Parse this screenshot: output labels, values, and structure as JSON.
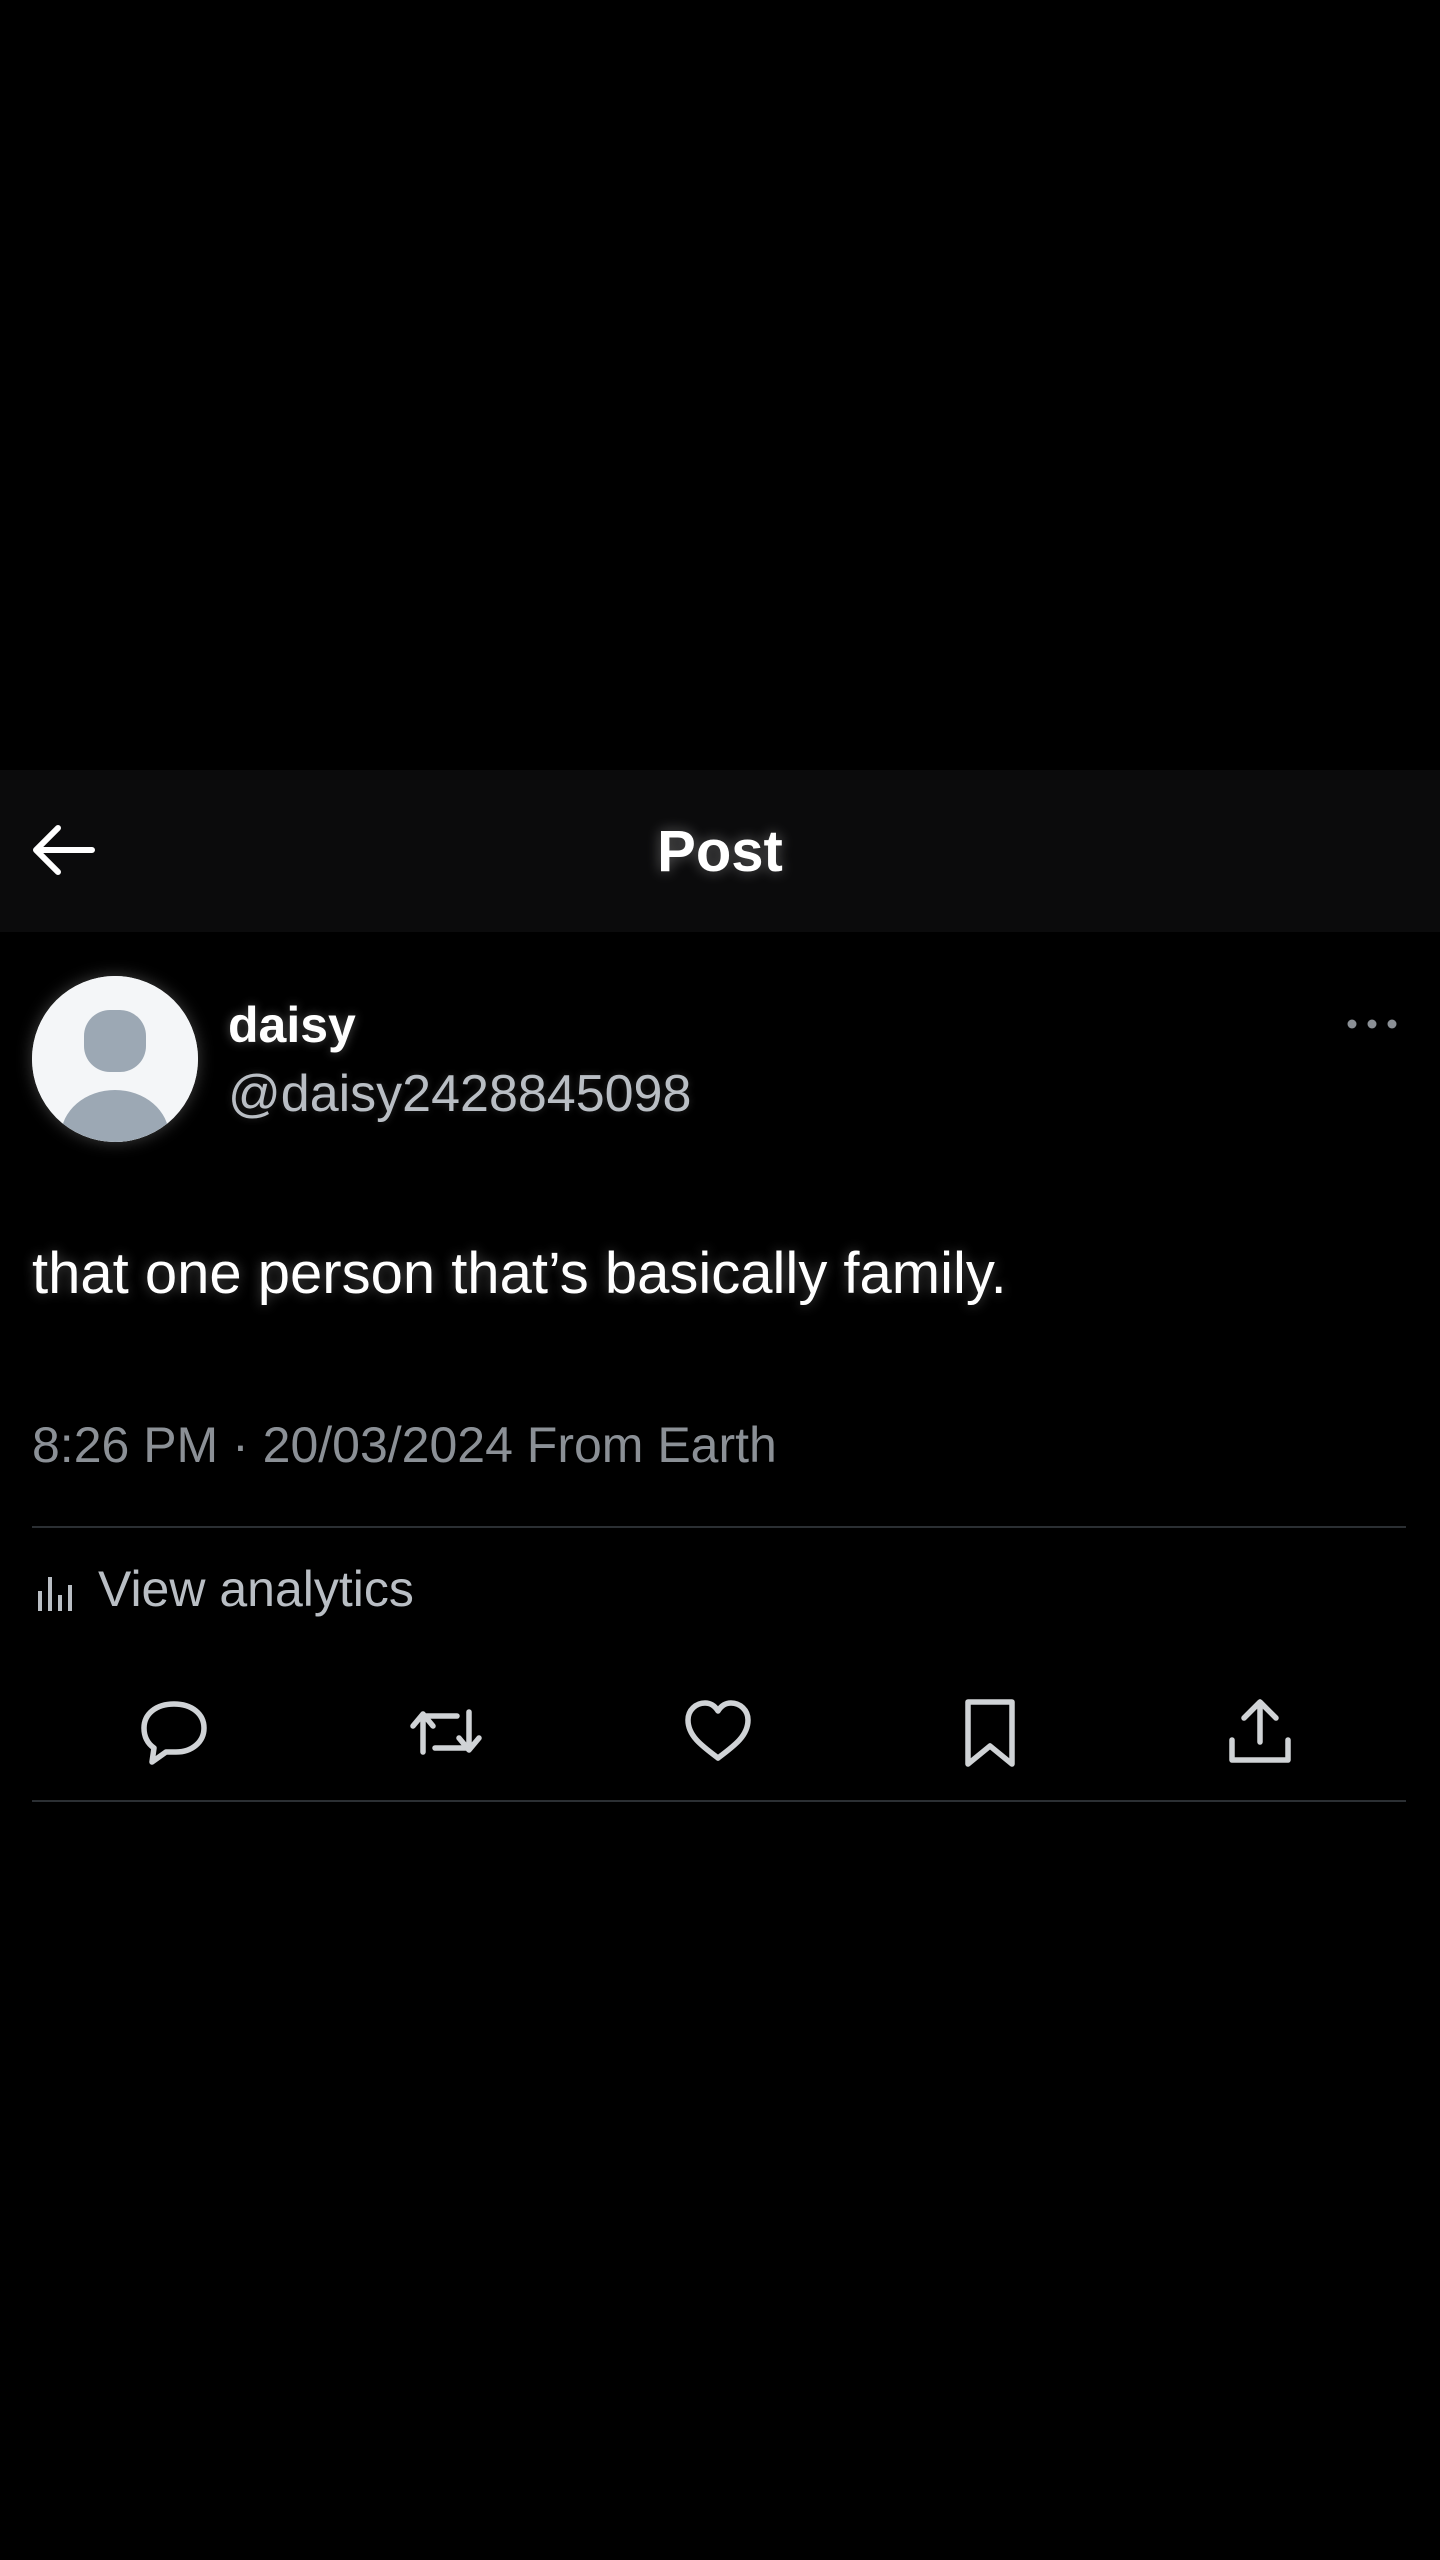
{
  "header": {
    "title": "Post",
    "back_icon": "arrow-left-icon"
  },
  "post": {
    "author": {
      "display_name": "daisy",
      "handle": "@daisy2428845098",
      "avatar_icon": "default-avatar-icon"
    },
    "more_icon": "more-horizontal-icon",
    "text": "that one person that’s basically family.",
    "meta": "8:26 PM · 20/03/2024 From Earth",
    "analytics": {
      "label": "View analytics",
      "icon": "bar-chart-icon"
    },
    "actions": [
      {
        "name": "reply",
        "icon": "reply-icon"
      },
      {
        "name": "repost",
        "icon": "repost-icon"
      },
      {
        "name": "like",
        "icon": "heart-icon"
      },
      {
        "name": "bookmark",
        "icon": "bookmark-icon"
      },
      {
        "name": "share",
        "icon": "share-icon"
      }
    ]
  },
  "colors": {
    "background": "#000000",
    "header_background": "#0b0b0c",
    "primary_text": "#ffffff",
    "secondary_text": "#8b9096",
    "divider": "#2b2f33",
    "icon": "#d0d3d6"
  }
}
